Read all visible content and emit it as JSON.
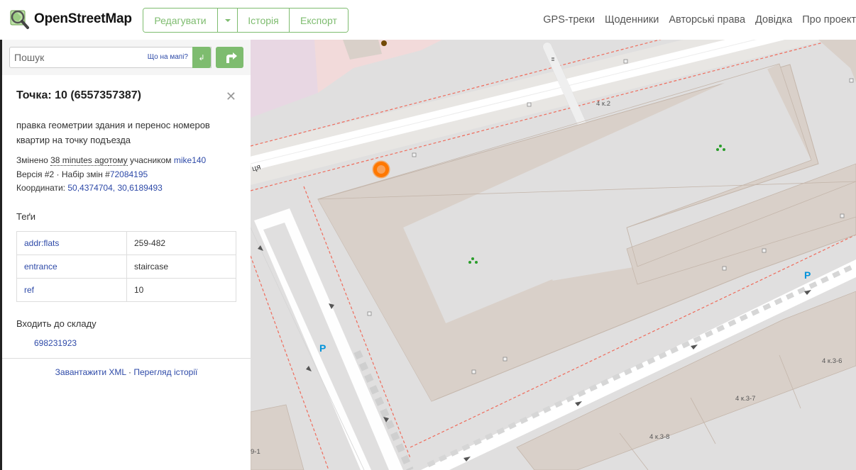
{
  "header": {
    "logo_text": "OpenStreetMap",
    "edit_label": "Редагувати",
    "history_label": "Історія",
    "export_label": "Експорт",
    "nav": [
      "GPS-треки",
      "Щоденники",
      "Авторські права",
      "Довідка",
      "Про проект"
    ]
  },
  "search": {
    "placeholder": "Пошук",
    "where_link": "Що на мапі?",
    "go_label": "↲"
  },
  "feature": {
    "title": "Точка: 10 (6557357387)",
    "comment": "правка геометрии здания и перенос номеров квартир на точку подъезда",
    "changed_prefix": "Змінено",
    "changed_time": "38 minutes ago",
    "changed_time_suffix": "тому",
    "changed_by": "учасником",
    "user": "mike140",
    "version_text": "Версія #2 · Набір змін #",
    "changeset": "72084195",
    "coords_label": "Координати:",
    "lat": "50,4374704",
    "lon": "30,6189493",
    "tags_heading": "Теґи",
    "tags": [
      {
        "key": "addr:flats",
        "value": "259-482"
      },
      {
        "key": "entrance",
        "value": "staircase"
      },
      {
        "key": "ref",
        "value": "10"
      }
    ],
    "part_of_heading": "Входить до складу",
    "relation": "698231923",
    "download_xml": "Завантажити XML",
    "sep": "·",
    "view_history": "Перегляд історії"
  },
  "map": {
    "labels": {
      "bldg_4k2": "4 к.2",
      "bldg_4k36": "4 к.3-6",
      "bldg_4k37": "4 к.3-7",
      "bldg_4k38": "4 к.3-8",
      "bldg_91": "9-1",
      "street": "ця",
      "parking_1": "P",
      "parking_2": "P"
    },
    "colors": {
      "building": "#d9d0c9",
      "marker": "#ff7800",
      "link": "#2e4aa8",
      "accent_green": "#7ebc6f"
    }
  }
}
